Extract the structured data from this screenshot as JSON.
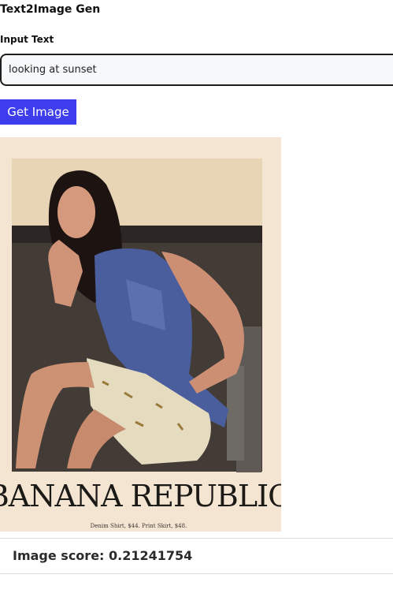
{
  "app": {
    "title": "Text2Image Gen"
  },
  "form": {
    "input_label": "Input Text",
    "input_value": "looking at sunset",
    "submit_label": "Get Image"
  },
  "result": {
    "brand_text": "BANANA REPUBLIC",
    "caption": "Denim Shirt, $44. Print Skirt, $48.",
    "score_label": "Image score:",
    "score_value": "0.21241754"
  },
  "colors": {
    "button": "#3d3dee",
    "input_border": "#1e1e1e",
    "input_bg": "#f7f8fa"
  }
}
